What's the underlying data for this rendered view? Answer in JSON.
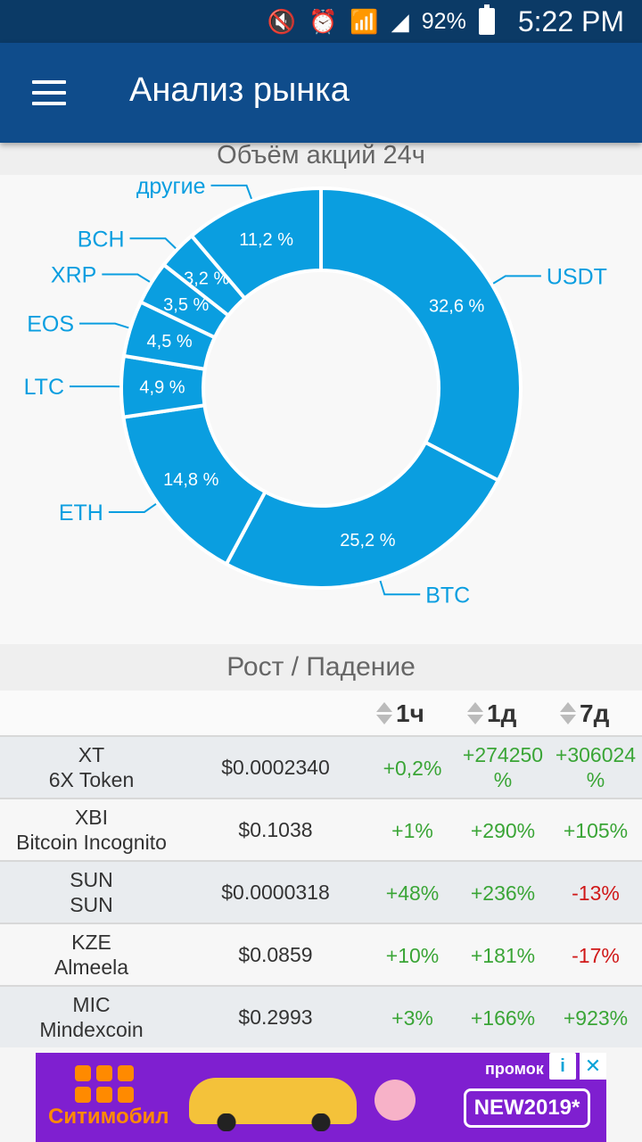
{
  "status_bar": {
    "battery": "92%",
    "time": "5:22 PM"
  },
  "app_bar": {
    "title": "Анализ рынка"
  },
  "chart_section": {
    "title": "Объём акций 24ч"
  },
  "chart_data": {
    "type": "pie",
    "title": "Объём акций 24ч",
    "labels": [
      "USDT",
      "BTC",
      "ETH",
      "LTC",
      "EOS",
      "XRP",
      "BCH",
      "другие"
    ],
    "values": [
      32.6,
      25.2,
      14.8,
      4.9,
      4.5,
      3.5,
      3.2,
      11.2
    ],
    "value_labels": [
      "32,6 %",
      "25,2 %",
      "14,8 %",
      "4,9 %",
      "4,5 %",
      "3,5 %",
      "3,2 %",
      "11,2 %"
    ],
    "color": "#0a9ee0",
    "donut": true
  },
  "table_section": {
    "title": "Рост / Падение"
  },
  "table": {
    "headers": [
      "1ч",
      "1д",
      "7д"
    ],
    "rows": [
      {
        "symbol": "XT",
        "name": "6X Token",
        "price": "$0.0002340",
        "h1": "+0,2%",
        "d1": "+274250 %",
        "d7": "+306024 %"
      },
      {
        "symbol": "XBI",
        "name": "Bitcoin Incognito",
        "price": "$0.1038",
        "h1": "+1%",
        "d1": "+290%",
        "d7": "+105%"
      },
      {
        "symbol": "SUN",
        "name": "SUN",
        "price": "$0.0000318",
        "h1": "+48%",
        "d1": "+236%",
        "d7": "-13%"
      },
      {
        "symbol": "KZE",
        "name": "Almeela",
        "price": "$0.0859",
        "h1": "+10%",
        "d1": "+181%",
        "d7": "-17%"
      },
      {
        "symbol": "MIC",
        "name": "Mindexcoin",
        "price": "$0.2993",
        "h1": "+3%",
        "d1": "+166%",
        "d7": "+923%"
      }
    ]
  },
  "ad": {
    "brand": "Ситимобил",
    "car_label": "Ситимобил",
    "promo_label": "промок",
    "promo_code": "NEW2019*",
    "info": "i",
    "close": "✕"
  }
}
